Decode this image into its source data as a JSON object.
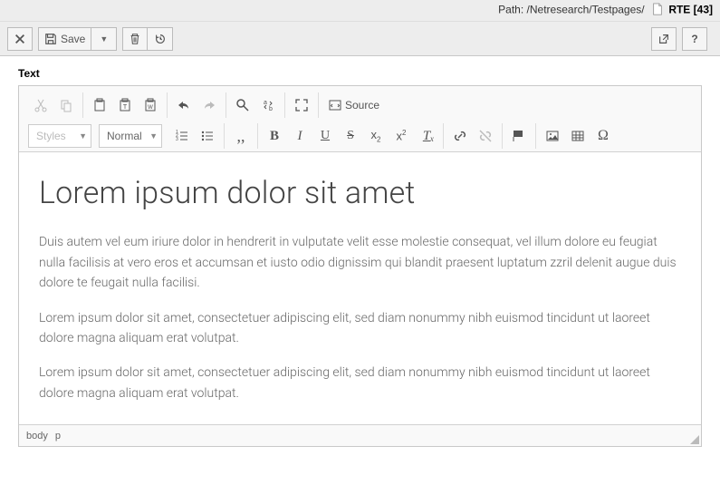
{
  "header": {
    "path_label": "Path:",
    "path_value": "/Netresearch/Testpages/",
    "page_title": "RTE",
    "page_id": "[43]"
  },
  "module_bar": {
    "save_label": "Save"
  },
  "section": {
    "label": "Text"
  },
  "editor": {
    "styles_combo": "Styles",
    "format_combo": "Normal",
    "source_label": "Source",
    "footer_path_body": "body",
    "footer_path_p": "p",
    "content": {
      "heading": "Lorem ipsum dolor sit amet",
      "p1": "Duis autem vel eum iriure dolor in hendrerit in vulputate velit esse molestie consequat, vel illum dolore eu feugiat nulla facilisis at vero eros et accumsan et iusto odio dignissim qui blandit praesent luptatum zzril delenit augue duis dolore te feugait nulla facilisi.",
      "p2": "Lorem ipsum dolor sit amet, consectetuer adipiscing elit, sed diam nonummy nibh euismod tincidunt ut laoreet dolore magna aliquam erat volutpat.",
      "p3": "Lorem ipsum dolor sit amet, consectetuer adipiscing elit, sed diam nonummy nibh euismod tincidunt ut laoreet dolore magna aliquam erat volutpat."
    }
  }
}
